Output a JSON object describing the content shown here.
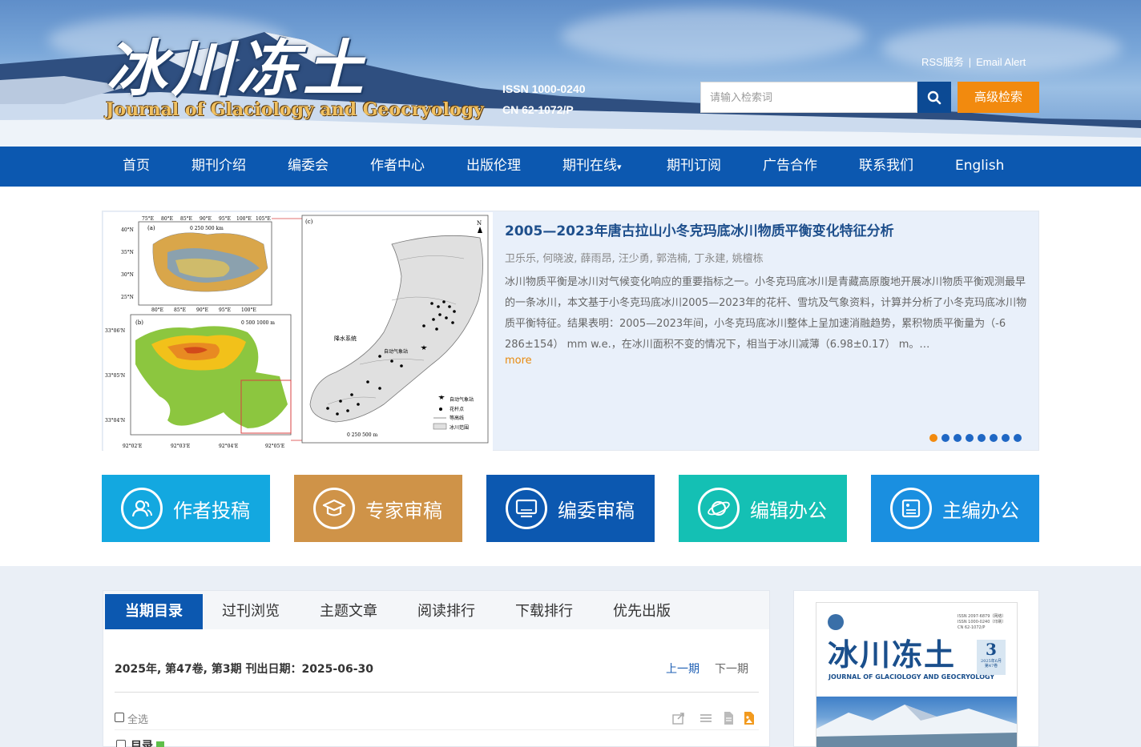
{
  "header": {
    "logo_cn": "冰川冻土",
    "logo_en": "Journal of Glaciology and Geocryology",
    "issn": "ISSN 1000-0240",
    "cn": "CN 62-1072/P",
    "rss": "RSS服务",
    "separator": "|",
    "email_alert": "Email Alert",
    "search_placeholder": "请输入检索词",
    "advanced_search": "高级检索"
  },
  "nav": {
    "items": [
      "首页",
      "期刊介绍",
      "编委会",
      "作者中心",
      "出版伦理",
      "期刊在线",
      "期刊订阅",
      "广告合作",
      "联系我们",
      "English"
    ],
    "dropdown_mark": "▾"
  },
  "feature": {
    "title": "2005—2023年唐古拉山小冬克玛底冰川物质平衡变化特征分析",
    "authors": "卫乐乐, 何晓波, 薛雨昂, 汪少勇, 郭浩楠, 丁永建, 姚檀栋",
    "abstract": "冰川物质平衡是冰川对气候变化响应的重要指标之一。小冬克玛底冰川是青藏高原腹地开展冰川物质平衡观测最早的一条冰川，本文基于小冬克玛底冰川2005—2023年的花杆、雪坑及气象资料，计算并分析了小冬克玛底冰川物质平衡特征。结果表明：2005—2023年间，小冬克玛底冰川整体上呈加速消融趋势，累积物质平衡量为（-6 286±154） mm w.e.，在冰川面积不变的情况下，相当于冰川减薄（6.98±0.17） m。…",
    "more": "more",
    "slide_count": 8,
    "active_slide": 1,
    "map_labels": {
      "lon_top": [
        "75°E",
        "80°E",
        "85°E",
        "90°E",
        "95°E",
        "100°E",
        "105°E"
      ],
      "lat_left": [
        "40°N",
        "35°N",
        "30°N",
        "25°N"
      ],
      "lon_bottom": [
        "80°E",
        "85°E",
        "90°E",
        "95°E",
        "100°E"
      ],
      "scale_a": "0 250 500 km",
      "scale_b": "0 500 1000 m",
      "scale_c": "0 250 500 m",
      "lat_b": [
        "33°06'N",
        "33°05'N",
        "33°04'N"
      ],
      "lon_b": [
        "92°02'E",
        "92°03'E",
        "92°04'E",
        "92°05'E"
      ],
      "panel_a": "(a)",
      "panel_b": "(b)",
      "panel_c": "(c)",
      "north": "N",
      "station_label": "降水系统",
      "weather_label": "自动气象站",
      "legend": [
        "自动气象站",
        "花杆点",
        "等高线",
        "冰川范围"
      ]
    }
  },
  "quick_buttons": [
    {
      "label": "作者投稿",
      "color": "#13a8e0",
      "icon": "user-group-icon"
    },
    {
      "label": "专家审稿",
      "color": "#cf9348",
      "icon": "graduation-cap-icon"
    },
    {
      "label": "编委审稿",
      "color": "#0c58b0",
      "icon": "monitor-icon"
    },
    {
      "label": "编辑办公",
      "color": "#14c0b4",
      "icon": "planet-icon"
    },
    {
      "label": "主编办公",
      "color": "#1a8fe0",
      "icon": "document-image-icon"
    }
  ],
  "toc": {
    "tabs": [
      "当期目录",
      "过刊浏览",
      "主题文章",
      "阅读排行",
      "下载排行",
      "优先出版"
    ],
    "issue_info": "2025年, 第47卷, 第3期   刊出日期：2025-06-30",
    "prev": "上一期",
    "next": "下一期",
    "select_all": "全选",
    "first_item": "目录"
  },
  "cover": {
    "title": "冰川冻土",
    "en": "JOURNAL OF GLACIOLOGY AND GEOCRYOLOGY",
    "issue_num": "3",
    "issn_lines": "ISSN 2097-6879（网络）\nISSN 1000-0240（印刷）\nCN 62-1072/P",
    "date_small": "2025年6月\n第47卷"
  },
  "colors": {
    "nav_bg": "#0c58b0",
    "accent_orange": "#f28a0e",
    "title_blue": "#1e4f8c"
  }
}
